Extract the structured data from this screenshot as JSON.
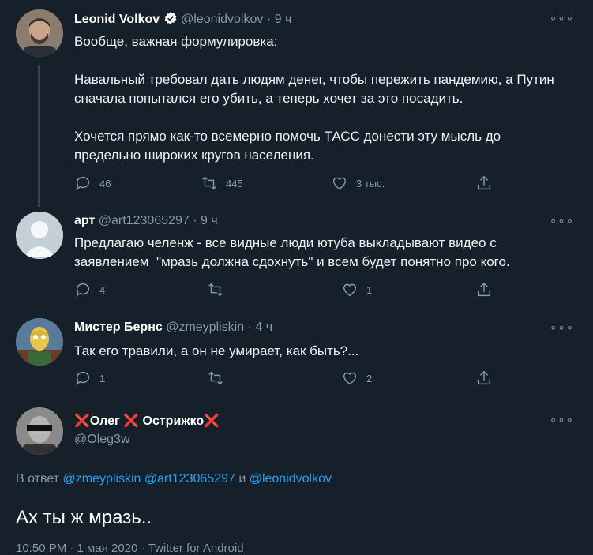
{
  "tweets": [
    {
      "name": "Leonid Volkov",
      "handle": "@leonidvolkov",
      "dot": "·",
      "time": "9 ч",
      "text": "Вообще, важная формулировка:\n\nНавальный требовал дать людям денег, чтобы пережить пандемию, а Путин сначала попытался его убить, а теперь хочет за это посадить.\n\nХочется прямо как-то всемерно помочь ТАСС донести эту мысль до предельно широких кругов населения.",
      "replies": "46",
      "retweets": "445",
      "likes": "3 тыс.",
      "more": "∘∘∘"
    },
    {
      "name": "арт",
      "handle": "@art123065297",
      "dot": "·",
      "time": "9 ч",
      "text": "Предлагаю челенж - все видные люди ютуба выкладывают видео с заявлением  \"мразь должна сдохнуть\" и всем будет понятно про кого.",
      "replies": "4",
      "retweets": "",
      "likes": "1",
      "more": "∘∘∘"
    },
    {
      "name": "Мистер Бернс",
      "handle": "@zmeypliskin",
      "dot": "·",
      "time": "4 ч",
      "text": "Так его травили, а он не умирает, как быть?...",
      "replies": "1",
      "retweets": "",
      "likes": "2",
      "more": "∘∘∘"
    }
  ],
  "main_tweet": {
    "name_part1": "Олег",
    "name_part2": "Острижко",
    "x_mark": "❌",
    "handle": "@Oleg3w",
    "more": "∘∘∘",
    "reply_prefix": "В ответ",
    "mention1": "@zmeypliskin",
    "mention2": "@art123065297",
    "and": "и",
    "mention3": "@leonidvolkov",
    "text": "Ах ты ж мразь..",
    "footer": "10:50 PM · 1 мая 2020 · Twitter for Android"
  },
  "colors": {
    "background": "#15202b",
    "accent": "#1da1f2",
    "muted": "#8899a6",
    "x_red": "#e0245e"
  }
}
